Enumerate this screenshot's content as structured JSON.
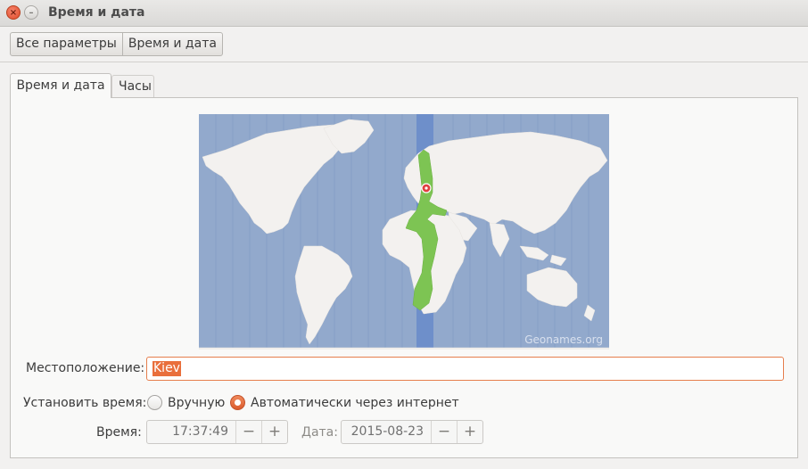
{
  "window": {
    "title": "Время и дата",
    "close_glyph": "×",
    "minimize_glyph": "–"
  },
  "toolbar": {
    "breadcrumbs": [
      "Все параметры",
      "Время и дата"
    ]
  },
  "tabs": [
    "Время и дата",
    "Часы"
  ],
  "map": {
    "credit": "Geonames.org",
    "ocean_color": "#92a9cc",
    "highlight_color": "#7dc453",
    "band_color": "#6e8fca"
  },
  "location": {
    "label": "Местоположение:",
    "value": "Kiev"
  },
  "set_time": {
    "label": "Установить время:",
    "options": [
      "Вручную",
      "Автоматически через интернет"
    ],
    "selected": "Автоматически через интернет"
  },
  "time": {
    "label": "Время:",
    "value": "17:37:49",
    "decrement": "−",
    "increment": "+"
  },
  "date": {
    "label": "Дата:",
    "value": "2015-08-23",
    "decrement": "−",
    "increment": "+"
  },
  "accent_color": "#e96f3c"
}
